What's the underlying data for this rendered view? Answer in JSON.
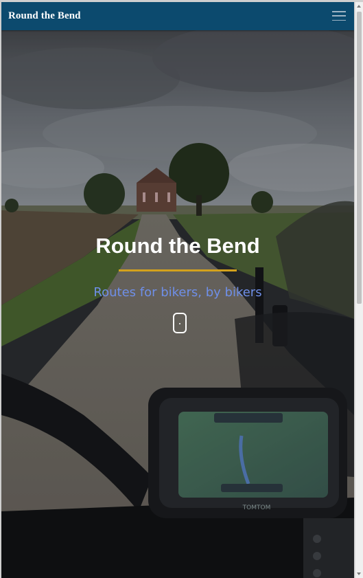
{
  "navbar": {
    "brand": "Round the Bend",
    "menu_icon": "hamburger-menu-icon"
  },
  "hero": {
    "title": "Round the Bend",
    "subtitle": "Routes for bikers, by bikers",
    "scroll_icon": "scroll-down-mouse-icon",
    "background_description_icon": "motorcycle-gps-road-photo",
    "gps_brand": "TOMTOM"
  },
  "colors": {
    "navbar": "#0c4a6e",
    "accent_divider": "#d4a21c",
    "subtitle": "#6f8fe8",
    "title": "#ffffff"
  }
}
